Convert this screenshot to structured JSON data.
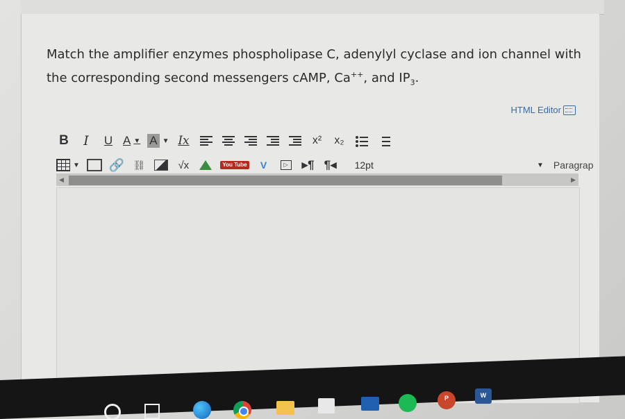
{
  "question": {
    "part1": "Match the amplifier enzymes phospholipase C, adenylyl cyclase and ion channel with",
    "part2": "the corresponding second messengers cAMP, Ca",
    "sup": "++",
    "part3": ", and IP",
    "sub": "3",
    "part4": "."
  },
  "editor": {
    "html_editor_label": "HTML Editor",
    "toolbar_row1": {
      "bold": "B",
      "italic": "I",
      "underline": "U",
      "font_color": "A",
      "bg_color": "A",
      "clear_format": "Ix",
      "superscript": "x²",
      "subscript": "x₂"
    },
    "toolbar_row2": {
      "formula": "√x",
      "youtube": "You Tube",
      "vimeo": "V",
      "ltr": "¶",
      "rtl": "¶",
      "font_size": "12pt",
      "paragraph": "Paragrap"
    }
  },
  "icons": [
    "table-icon",
    "media-icon",
    "link-icon",
    "unlink-icon",
    "image-icon",
    "google-drive-icon",
    "youtube-icon",
    "vimeo-icon",
    "embed-icon"
  ],
  "taskbar": [
    "search-icon",
    "task-view-icon",
    "edge-icon",
    "chrome-icon",
    "file-explorer-icon",
    "store-icon",
    "mail-icon",
    "spotify-icon",
    "powerpoint-icon",
    "word-icon"
  ],
  "taskbar_labels": {
    "powerpoint": "P",
    "word": "W"
  }
}
